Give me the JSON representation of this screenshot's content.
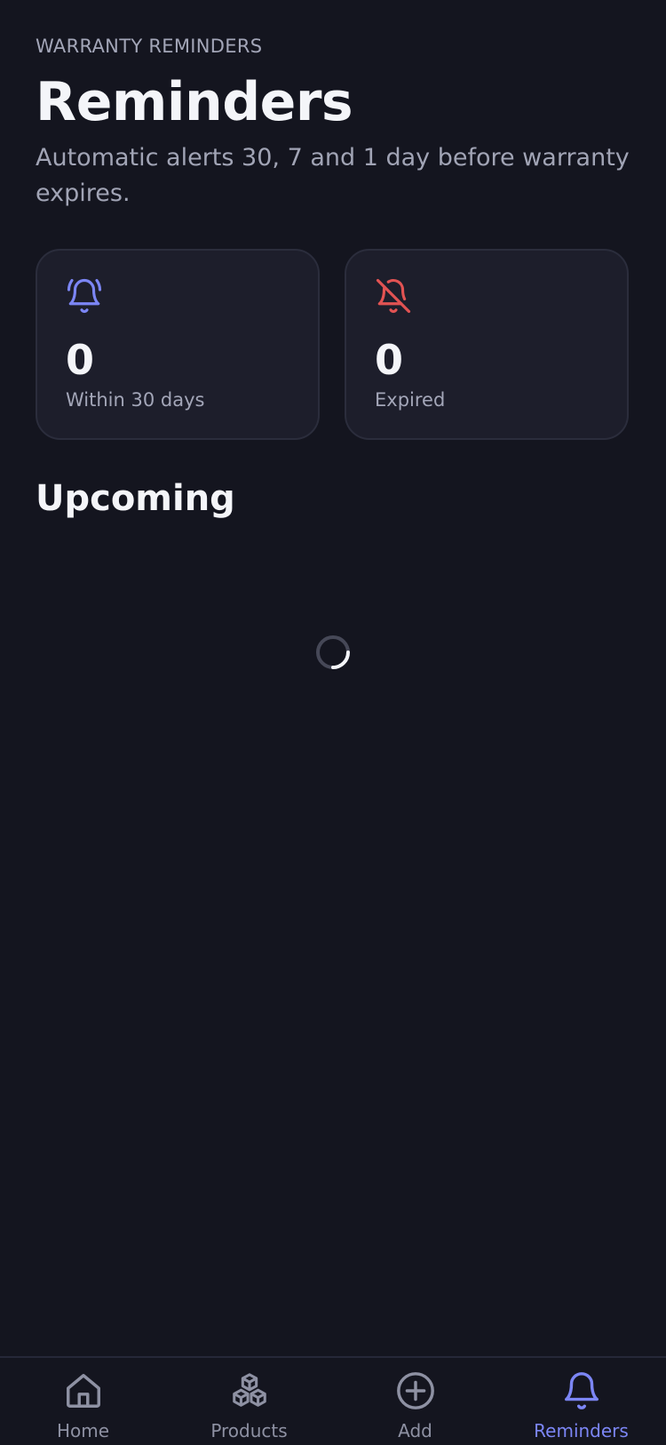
{
  "header": {
    "eyebrow": "WARRANTY REMINDERS",
    "title": "Reminders",
    "subtitle": "Automatic alerts 30, 7 and 1 day before warranty expires."
  },
  "stats": [
    {
      "icon": "bell-ringing-icon",
      "value": "0",
      "label": "Within 30 days",
      "color": "#7c86f5"
    },
    {
      "icon": "bell-off-icon",
      "value": "0",
      "label": "Expired",
      "color": "#e25353"
    }
  ],
  "upcoming": {
    "title": "Upcoming",
    "state": "loading"
  },
  "tabbar": {
    "active": "reminders",
    "accent": "#7c86f5",
    "items": [
      {
        "id": "home",
        "label": "Home",
        "icon": "home-icon"
      },
      {
        "id": "products",
        "label": "Products",
        "icon": "cubes-icon"
      },
      {
        "id": "add",
        "label": "Add",
        "icon": "plus-circle-icon"
      },
      {
        "id": "reminders",
        "label": "Reminders",
        "icon": "bell-icon"
      }
    ]
  }
}
